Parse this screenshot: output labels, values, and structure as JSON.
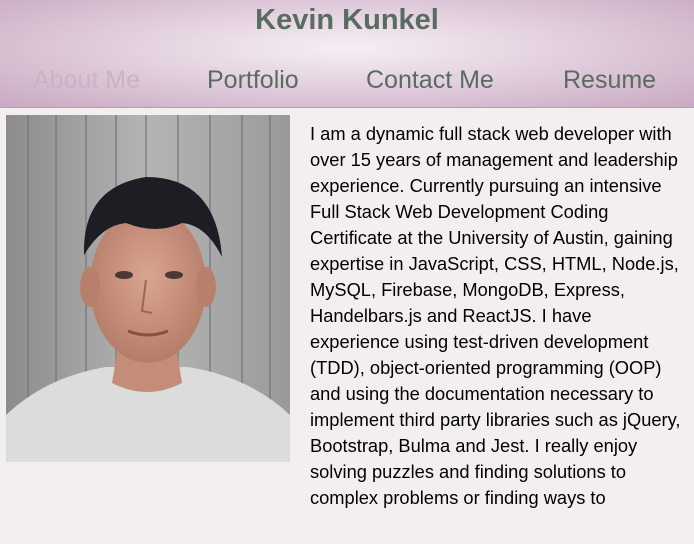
{
  "header": {
    "title": "Kevin Kunkel"
  },
  "nav": {
    "items": [
      {
        "label": "About Me",
        "active": true
      },
      {
        "label": "Portfolio",
        "active": false
      },
      {
        "label": "Contact Me",
        "active": false
      },
      {
        "label": "Resume",
        "active": false
      }
    ]
  },
  "about": {
    "bio": "I am a dynamic full stack web developer with over 15 years of management and leadership experience. Currently pursuing an intensive Full Stack Web Development Coding Certificate at the University of Austin, gaining expertise in JavaScript, CSS, HTML, Node.js, MySQL, Firebase, MongoDB, Express, Handelbars.js and ReactJS. I have experience using test-driven development (TDD), object-oriented programming (OOP) and using the documentation necessary to implement third party libraries such as jQuery, Bootstrap, Bulma and Jest. I really enjoy solving puzzles and finding solutions to complex problems or finding ways to"
  },
  "colors": {
    "title": "#5a6b61",
    "nav_active": "#c9b3c5",
    "background": "#f3eff1"
  }
}
